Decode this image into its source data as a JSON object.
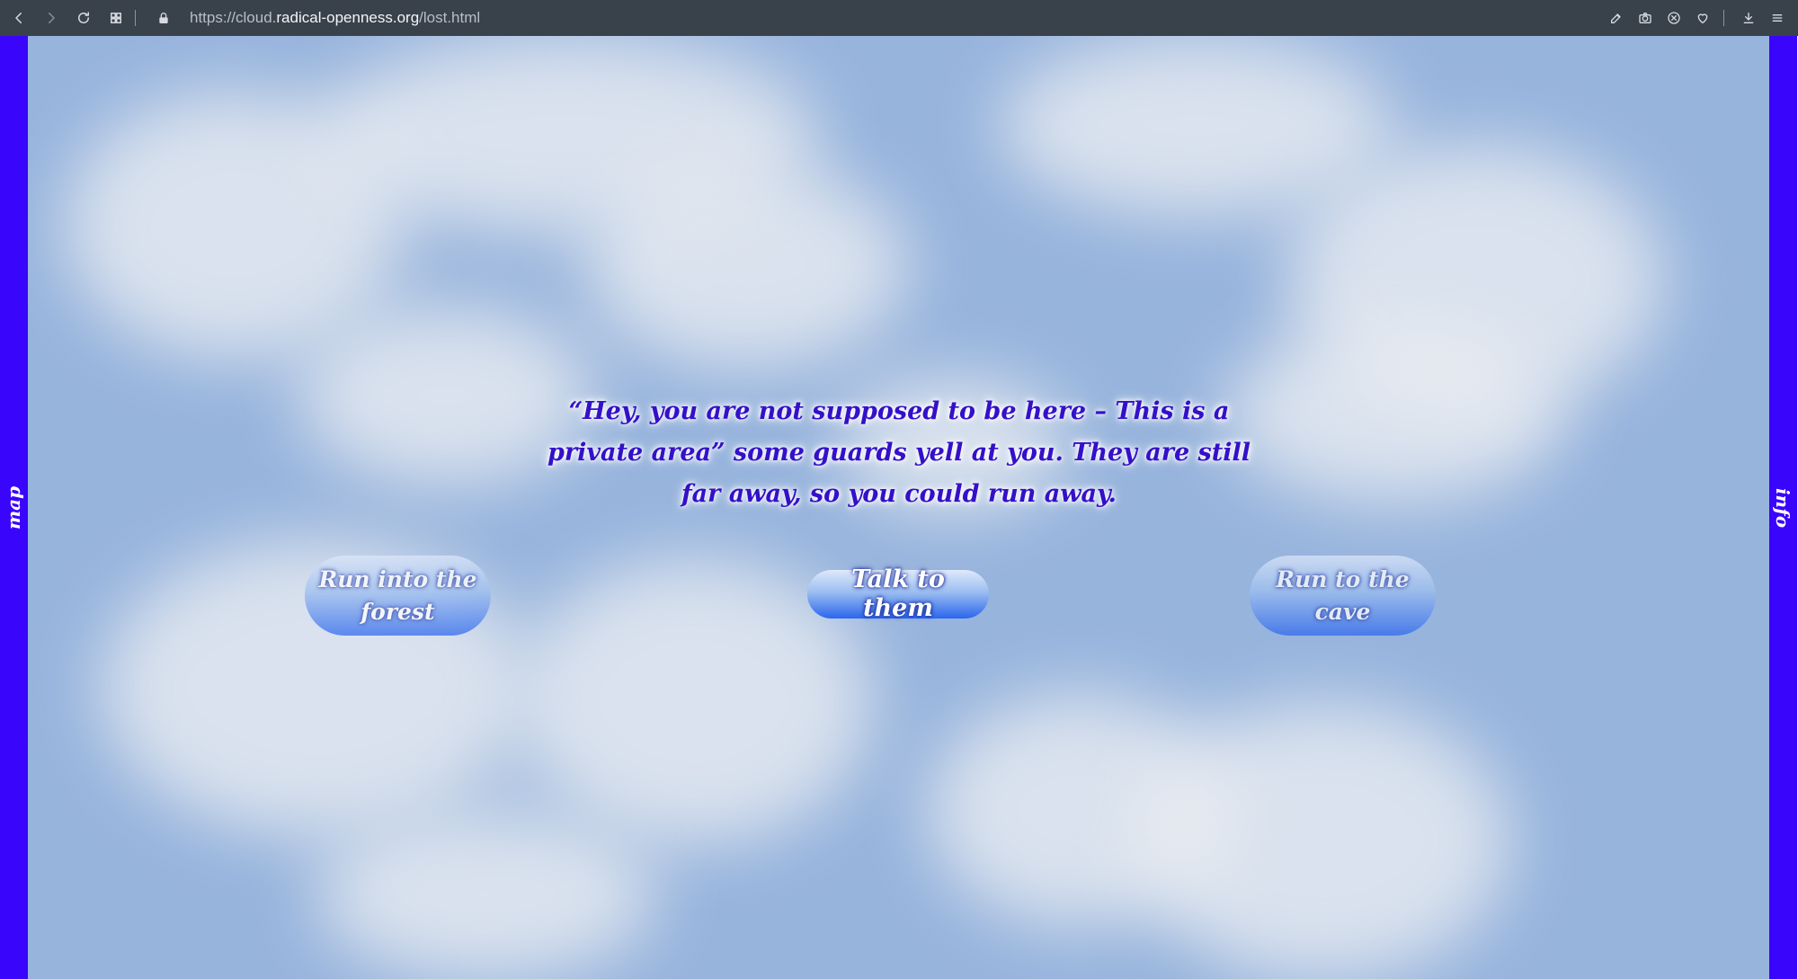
{
  "browser": {
    "url_scheme": "https://cloud.",
    "url_host": "radical-openness.org",
    "url_path": "/lost.html",
    "icons": {
      "back": "back-icon",
      "forward": "forward-icon",
      "reload": "reload-icon",
      "tabs": "tab-grid-icon",
      "lock": "lock-icon",
      "right": [
        "edit-icon",
        "camera-icon",
        "block-icon",
        "heart-icon",
        "download-icon",
        "menu-icon"
      ]
    }
  },
  "sidebar": {
    "left_label": "map",
    "right_label": "info"
  },
  "scene": {
    "text": "“Hey, you are not supposed to be here – This is a private area” some guards yell at you. They are still far away, so you could run away."
  },
  "choices": {
    "forest": "Run into the forest",
    "talk": "Talk to them",
    "cave": "Run to the cave"
  },
  "colors": {
    "sidebar": "#3a05fb",
    "sky": "#97b4dd",
    "story_text": "#3410c8",
    "toolbar": "#39414b"
  }
}
